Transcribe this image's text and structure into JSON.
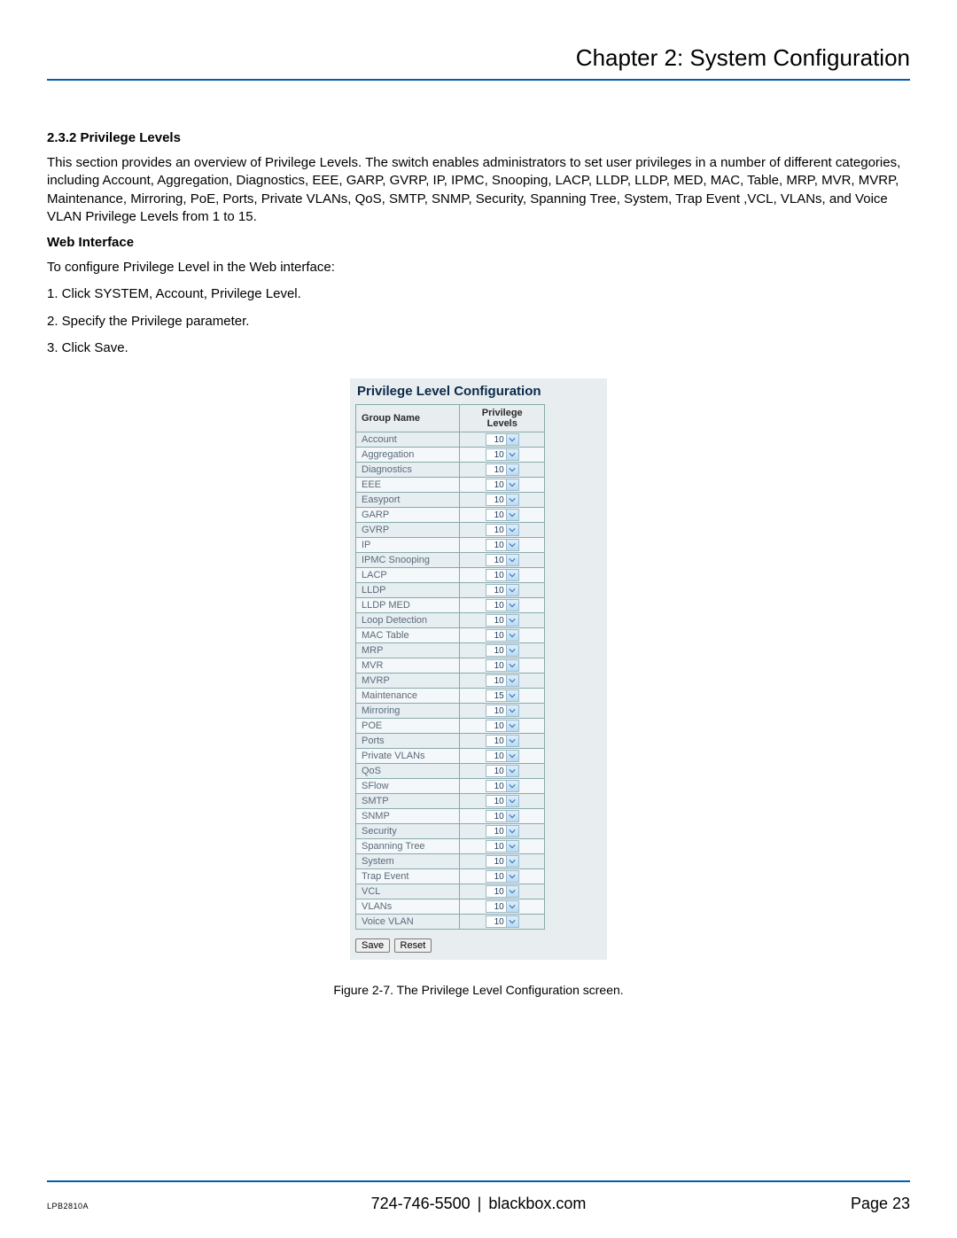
{
  "header": {
    "chapter_title": "Chapter 2: System Configuration"
  },
  "section": {
    "heading": "2.3.2 Privilege Levels",
    "body": "This section provides an overview of Privilege Levels. The switch enables administrators to set user privileges in a number of different categories, including Account, Aggregation, Diagnostics, EEE, GARP, GVRP, IP, IPMC, Snooping, LACP, LLDP, LLDP, MED, MAC, Table, MRP, MVR, MVRP, Maintenance, Mirroring, PoE, Ports, Private VLANs, QoS, SMTP, SNMP, Security, Spanning Tree, System, Trap Event ,VCL, VLANs, and Voice VLAN Privilege Levels from 1 to 15.",
    "sub_heading": "Web Interface",
    "intro": "To configure Privilege Level in the Web interface:",
    "steps": [
      "1. Click SYSTEM, Account, Privilege Level.",
      "2. Specify the Privilege parameter.",
      "3. Click Save."
    ]
  },
  "screenshot": {
    "title": "Privilege Level Configuration",
    "col_group": "Group Name",
    "col_level": "Privilege Levels",
    "rows": [
      {
        "name": "Account",
        "value": "10"
      },
      {
        "name": "Aggregation",
        "value": "10"
      },
      {
        "name": "Diagnostics",
        "value": "10"
      },
      {
        "name": "EEE",
        "value": "10"
      },
      {
        "name": "Easyport",
        "value": "10"
      },
      {
        "name": "GARP",
        "value": "10"
      },
      {
        "name": "GVRP",
        "value": "10"
      },
      {
        "name": "IP",
        "value": "10"
      },
      {
        "name": "IPMC Snooping",
        "value": "10"
      },
      {
        "name": "LACP",
        "value": "10"
      },
      {
        "name": "LLDP",
        "value": "10"
      },
      {
        "name": "LLDP MED",
        "value": "10"
      },
      {
        "name": "Loop Detection",
        "value": "10"
      },
      {
        "name": "MAC Table",
        "value": "10"
      },
      {
        "name": "MRP",
        "value": "10"
      },
      {
        "name": "MVR",
        "value": "10"
      },
      {
        "name": "MVRP",
        "value": "10"
      },
      {
        "name": "Maintenance",
        "value": "15"
      },
      {
        "name": "Mirroring",
        "value": "10"
      },
      {
        "name": "POE",
        "value": "10"
      },
      {
        "name": "Ports",
        "value": "10"
      },
      {
        "name": "Private VLANs",
        "value": "10"
      },
      {
        "name": "QoS",
        "value": "10"
      },
      {
        "name": "SFlow",
        "value": "10"
      },
      {
        "name": "SMTP",
        "value": "10"
      },
      {
        "name": "SNMP",
        "value": "10"
      },
      {
        "name": "Security",
        "value": "10"
      },
      {
        "name": "Spanning Tree",
        "value": "10"
      },
      {
        "name": "System",
        "value": "10"
      },
      {
        "name": "Trap Event",
        "value": "10"
      },
      {
        "name": "VCL",
        "value": "10"
      },
      {
        "name": "VLANs",
        "value": "10"
      },
      {
        "name": "Voice VLAN",
        "value": "10"
      }
    ],
    "buttons": {
      "save": "Save",
      "reset": "Reset"
    }
  },
  "figure_caption": "Figure 2-7. The Privilege Level Configuration screen.",
  "footer": {
    "model": "LPB2810A",
    "phone": "724-746-5500",
    "site": "blackbox.com",
    "page_label": "Page 23"
  }
}
